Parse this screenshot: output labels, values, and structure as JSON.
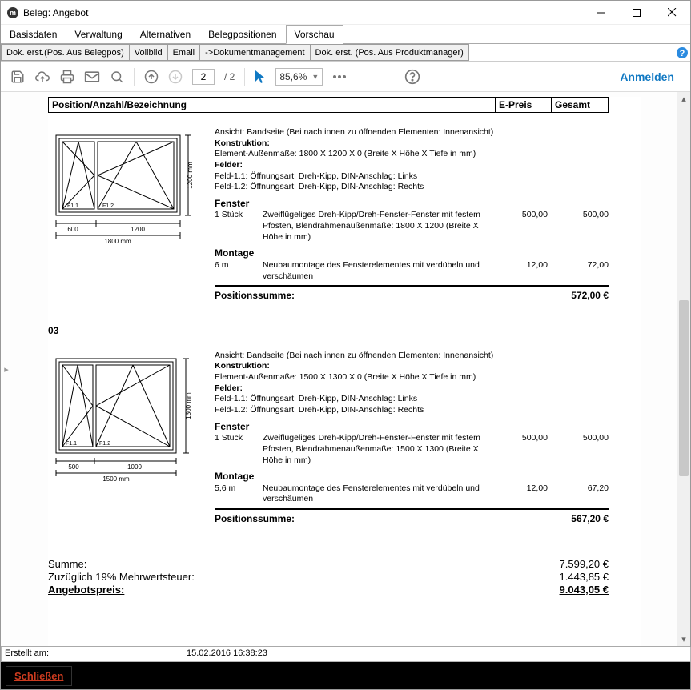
{
  "window": {
    "title": "Beleg: Angebot"
  },
  "main_tabs": [
    "Basisdaten",
    "Verwaltung",
    "Alternativen",
    "Belegpositionen",
    "Vorschau"
  ],
  "main_tab_active": 4,
  "sub_toolbar": {
    "buttons": [
      "Dok. erst.(Pos. Aus Belegpos)",
      "Vollbild",
      "Email",
      "->Dokumentmanagement",
      "Dok. erst. (Pos. Aus Produktmanager)"
    ]
  },
  "pdf_viewer": {
    "page_current": "2",
    "page_total": "/  2",
    "zoom": "85,6%",
    "login": "Anmelden"
  },
  "doc_header": {
    "col1": "Position/Anzahl/Bezeichnung",
    "col2": "E-Preis",
    "col3": "Gesamt"
  },
  "positions": [
    {
      "drawing": {
        "width_label": "1800 mm",
        "left_seg": "600",
        "right_seg": "1200",
        "height_label": "1200 mm",
        "f1": "F1.1",
        "f2": "F1.2"
      },
      "view": "Ansicht: Bandseite (Bei nach innen zu öffnenden Elementen: Innenansicht)",
      "konstruktion_label": "Konstruktion:",
      "element": "Element-Außenmaße: 1800 X 1200 X 0 (Breite X Höhe X Tiefe in mm)",
      "felder_label": "Felder:",
      "feld1": "Feld-1.1: Öffnungsart: Dreh-Kipp, DIN-Anschlag: Links",
      "feld2": "Feld-1.2: Öffnungsart: Dreh-Kipp, DIN-Anschlag: Rechts",
      "fenster_head": "Fenster",
      "fenster_qty": "1 Stück",
      "fenster_desc": "Zweiflügeliges Dreh-Kipp/Dreh-Fenster-Fenster mit festem Pfosten, Blendrahmenaußenmaße: 1800 X 1200 (Breite X Höhe in mm)",
      "fenster_ep": "500,00",
      "fenster_g": "500,00",
      "montage_head": "Montage",
      "montage_qty": "6 m",
      "montage_desc": "Neubaumontage des Fensterelementes mit verdübeln und verschäumen",
      "montage_ep": "12,00",
      "montage_g": "72,00",
      "sum_label": "Positionssumme:",
      "sum_value": "572,00 €"
    },
    {
      "num": "03",
      "drawing": {
        "width_label": "1500 mm",
        "left_seg": "500",
        "right_seg": "1000",
        "height_label": "1300 mm",
        "f1": "F1.1",
        "f2": "F1.2"
      },
      "view": "Ansicht: Bandseite (Bei nach innen zu öffnenden Elementen: Innenansicht)",
      "konstruktion_label": "Konstruktion:",
      "element": "Element-Außenmaße: 1500 X 1300 X 0 (Breite X Höhe X Tiefe in mm)",
      "felder_label": "Felder:",
      "feld1": "Feld-1.1: Öffnungsart: Dreh-Kipp, DIN-Anschlag: Links",
      "feld2": "Feld-1.2: Öffnungsart: Dreh-Kipp, DIN-Anschlag: Rechts",
      "fenster_head": "Fenster",
      "fenster_qty": "1 Stück",
      "fenster_desc": "Zweiflügeliges Dreh-Kipp/Dreh-Fenster-Fenster mit festem Pfosten, Blendrahmenaußenmaße: 1500 X 1300 (Breite X Höhe in mm)",
      "fenster_ep": "500,00",
      "fenster_g": "500,00",
      "montage_head": "Montage",
      "montage_qty": "5,6 m",
      "montage_desc": "Neubaumontage des Fensterelementes mit verdübeln und verschäumen",
      "montage_ep": "12,00",
      "montage_g": "67,20",
      "sum_label": "Positionssumme:",
      "sum_value": "567,20 €"
    }
  ],
  "totals": {
    "sum_label": "Summe:",
    "sum_value": "7.599,20 €",
    "tax_label": "Zuzüglich 19% Mehrwertsteuer:",
    "tax_value": "1.443,85 €",
    "price_label": "Angebotspreis:",
    "price_value": "9.043,05 €"
  },
  "status": {
    "label": "Erstellt am:",
    "value": "15.02.2016 16:38:23"
  },
  "bottom": {
    "close": "Schließen"
  }
}
